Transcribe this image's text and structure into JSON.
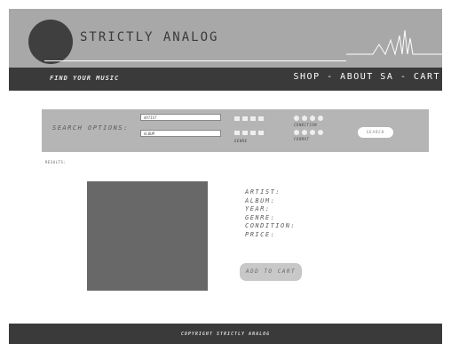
{
  "header": {
    "brand": "STRICTLY ANALOG",
    "tagline": "FIND YOUR MUSIC"
  },
  "nav": {
    "shop": "SHOP",
    "sep1": " - ",
    "about": "ABOUT SA",
    "sep2": " - ",
    "cart": "CART"
  },
  "search": {
    "label": "SEARCH OPTIONS:",
    "artist_placeholder": "ARTIST",
    "album_placeholder": "ALBUM",
    "genre_label": "GENRE",
    "condition_label": "CONDITION",
    "format_label": "FORMAT",
    "button_label": "SEARCH"
  },
  "results": {
    "label": "RESULTS:"
  },
  "product": {
    "artist_label": "ARTIST:",
    "album_label": "ALBUM:",
    "year_label": "YEAR:",
    "genre_label": "GENRE:",
    "condition_label": "CONDITION:",
    "price_label": "PRICE:",
    "add_to_cart": "ADD TO CART"
  },
  "footer": {
    "copyright": "COPYRIGHT STRICTLY ANALOG"
  },
  "colors": {
    "header_bg": "#a8a8a8",
    "nav_bg": "#3a3a3a",
    "panel_bg": "#b5b5b5",
    "album_art": "#686868"
  }
}
